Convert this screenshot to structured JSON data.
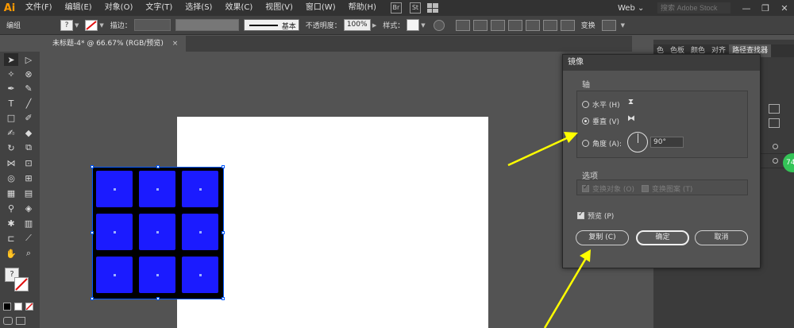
{
  "menubar": {
    "logo": "Ai",
    "items": [
      "文件(F)",
      "编辑(E)",
      "对象(O)",
      "文字(T)",
      "选择(S)",
      "效果(C)",
      "视图(V)",
      "窗口(W)",
      "帮助(H)"
    ],
    "badges": [
      "Br",
      "St"
    ],
    "workspace": "Web ⌄",
    "stock_search_placeholder": "搜索 Adobe Stock"
  },
  "controlbar": {
    "mode_label": "编组",
    "stroke_label": "描边：",
    "stroke_style_label": "基本",
    "opacity_label": "不透明度：",
    "opacity_value": "100%",
    "style_label": "样式：",
    "transform_label": "变换"
  },
  "document_tab": {
    "title": "未标题-4* @ 66.67% (RGB/预览)",
    "close_glyph": "×"
  },
  "panel_tabs": [
    "色",
    "色板",
    "颜色",
    "对齐",
    "路径查找器"
  ],
  "layer_badge": "74",
  "dialog": {
    "title": "镜像",
    "axis_group_label": "轴",
    "horizontal_label": "水平 (H)",
    "vertical_label": "垂直 (V)",
    "angle_label": "角度 (A):",
    "angle_value": "90°",
    "axis_selected": "vertical",
    "options_group_label": "选项",
    "transform_objects_label": "变换对象 (O)",
    "transform_patterns_label": "变换图案 (T)",
    "preview_label": "预览 (P)",
    "preview_checked": true,
    "copy_button": "复制 (C)",
    "ok_button": "确定",
    "cancel_button": "取消"
  },
  "tools": {
    "fill_stroke_question": "?"
  },
  "colors": {
    "tile_fill": "#1b1bff",
    "selection": "#0058ff",
    "annotation_arrow": "#ffff00",
    "app_accent": "#ff9a00"
  }
}
